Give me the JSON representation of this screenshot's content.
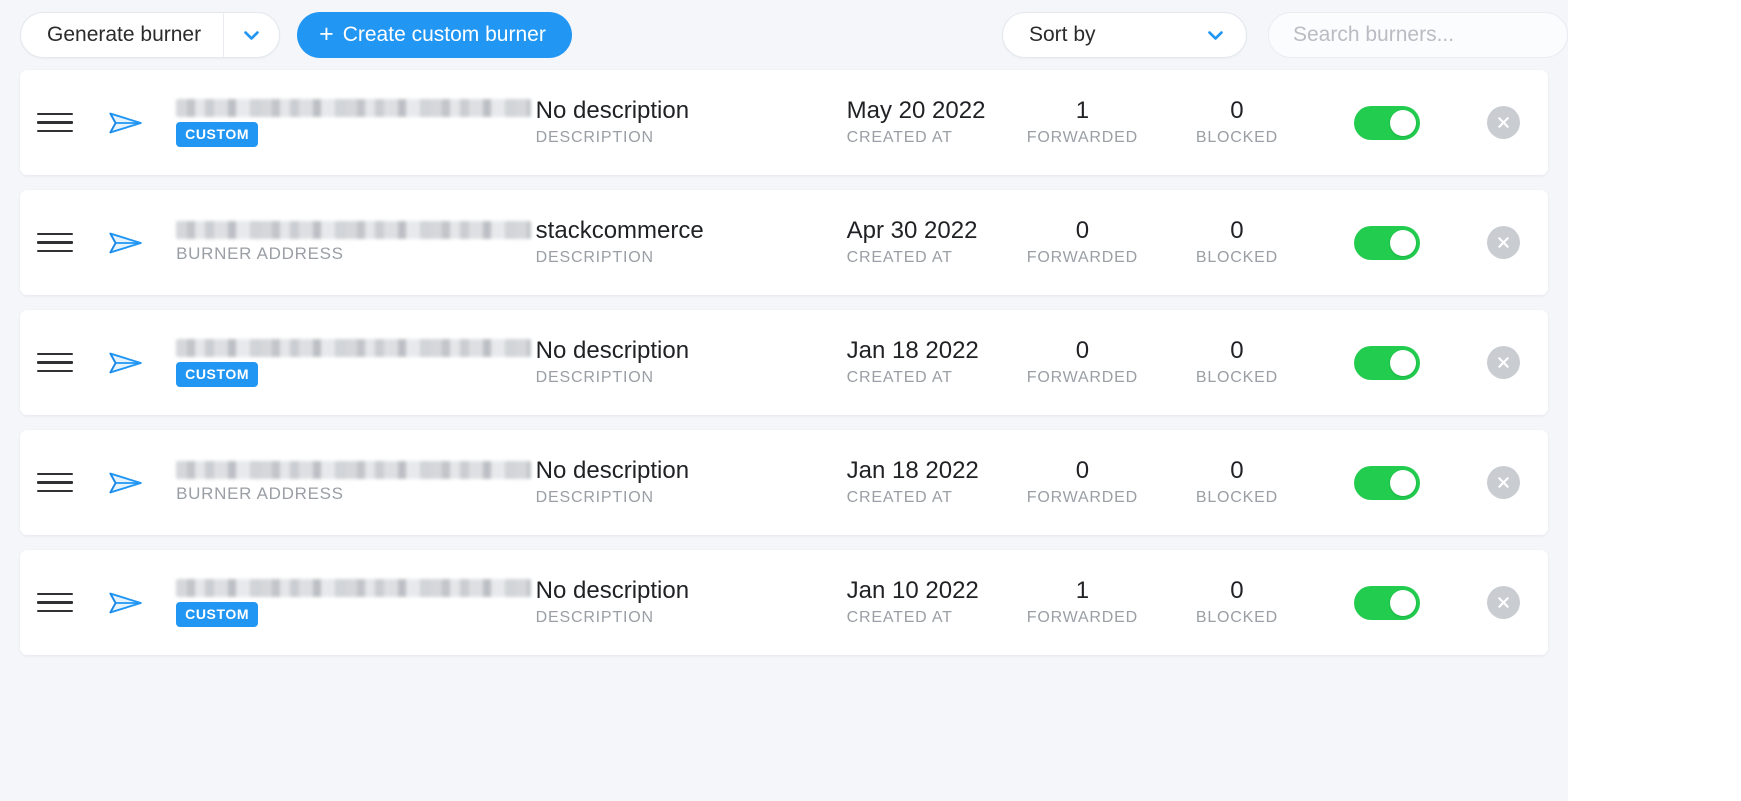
{
  "toolbar": {
    "generate_label": "Generate burner",
    "generate_caret_icon": "chevron-down-icon",
    "create_label": "Create custom burner",
    "create_plus": "+",
    "sort_label": "Sort by",
    "sort_caret_icon": "chevron-down-icon",
    "search_placeholder": "Search burners...",
    "search_value": "",
    "search_icon": "search-icon"
  },
  "colors": {
    "accent_blue": "#2196f3",
    "toggle_green": "#22cc4e",
    "close_grey": "#c9cdd2",
    "page_bg": "#f4f6f9",
    "card_bg": "#ffffff",
    "label_grey": "#9a9ea5"
  },
  "labels": {
    "burner_address": "BURNER ADDRESS",
    "custom_badge": "CUSTOM",
    "description": "DESCRIPTION",
    "created_at": "CREATED AT",
    "forwarded": "FORWARDED",
    "blocked": "BLOCKED"
  },
  "rows": [
    {
      "handle_icon": "drag-handle-icon",
      "plane_icon": "paper-plane-icon",
      "address": "",
      "address_redacted": true,
      "sub_kind": "badge",
      "sub_label": "CUSTOM",
      "description": "No description",
      "description_label": "DESCRIPTION",
      "created_at": "May 20 2022",
      "created_at_label": "CREATED AT",
      "forwarded": "1",
      "forwarded_label": "FORWARDED",
      "blocked": "0",
      "blocked_label": "BLOCKED",
      "enabled": true,
      "close_icon": "close-icon"
    },
    {
      "handle_icon": "drag-handle-icon",
      "plane_icon": "paper-plane-icon",
      "address": "",
      "address_redacted": true,
      "sub_kind": "text",
      "sub_label": "BURNER ADDRESS",
      "description": "stackcommerce",
      "description_label": "DESCRIPTION",
      "created_at": "Apr 30 2022",
      "created_at_label": "CREATED AT",
      "forwarded": "0",
      "forwarded_label": "FORWARDED",
      "blocked": "0",
      "blocked_label": "BLOCKED",
      "enabled": true,
      "close_icon": "close-icon"
    },
    {
      "handle_icon": "drag-handle-icon",
      "plane_icon": "paper-plane-icon",
      "address": "",
      "address_redacted": true,
      "sub_kind": "badge",
      "sub_label": "CUSTOM",
      "description": "No description",
      "description_label": "DESCRIPTION",
      "created_at": "Jan 18 2022",
      "created_at_label": "CREATED AT",
      "forwarded": "0",
      "forwarded_label": "FORWARDED",
      "blocked": "0",
      "blocked_label": "BLOCKED",
      "enabled": true,
      "close_icon": "close-icon"
    },
    {
      "handle_icon": "drag-handle-icon",
      "plane_icon": "paper-plane-icon",
      "address": "",
      "address_redacted": true,
      "sub_kind": "text",
      "sub_label": "BURNER ADDRESS",
      "description": "No description",
      "description_label": "DESCRIPTION",
      "created_at": "Jan 18 2022",
      "created_at_label": "CREATED AT",
      "forwarded": "0",
      "forwarded_label": "FORWARDED",
      "blocked": "0",
      "blocked_label": "BLOCKED",
      "enabled": true,
      "close_icon": "close-icon"
    },
    {
      "handle_icon": "drag-handle-icon",
      "plane_icon": "paper-plane-icon",
      "address": "",
      "address_redacted": true,
      "sub_kind": "badge",
      "sub_label": "CUSTOM",
      "description": "No description",
      "description_label": "DESCRIPTION",
      "created_at": "Jan 10 2022",
      "created_at_label": "CREATED AT",
      "forwarded": "1",
      "forwarded_label": "FORWARDED",
      "blocked": "0",
      "blocked_label": "BLOCKED",
      "enabled": true,
      "close_icon": "close-icon"
    }
  ]
}
